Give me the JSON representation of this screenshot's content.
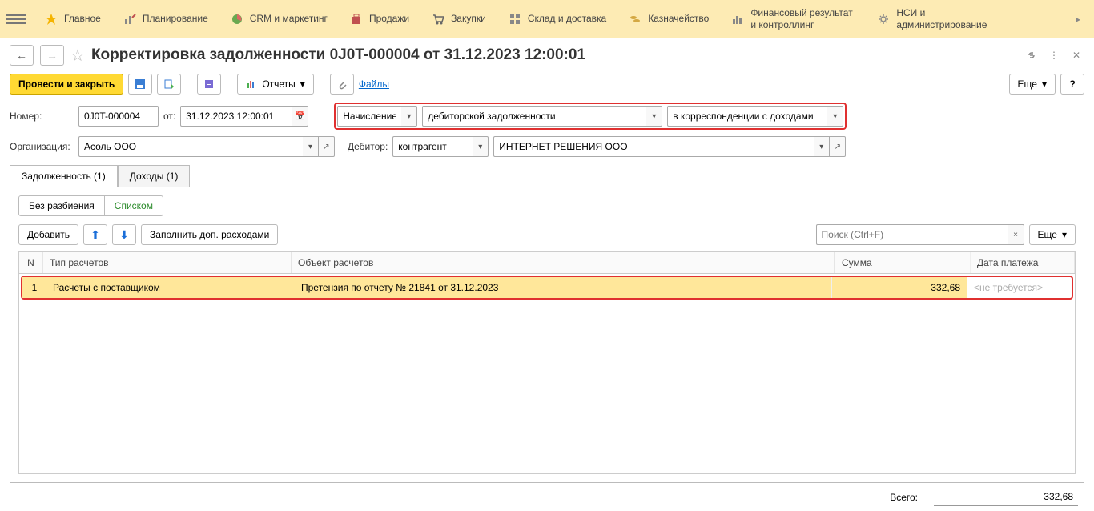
{
  "topbar": {
    "items": [
      {
        "label": "Главное"
      },
      {
        "label": "Планирование"
      },
      {
        "label": "CRM и маркетинг"
      },
      {
        "label": "Продажи"
      },
      {
        "label": "Закупки"
      },
      {
        "label": "Склад и доставка"
      },
      {
        "label": "Казначейство"
      },
      {
        "label": "Финансовый результат и контроллинг"
      },
      {
        "label": "НСИ и администрирование"
      }
    ]
  },
  "header": {
    "title": "Корректировка задолженности 0J0T-000004 от 31.12.2023 12:00:01"
  },
  "toolbar": {
    "post_close": "Провести и закрыть",
    "reports": "Отчеты",
    "files": "Файлы",
    "more": "Еще"
  },
  "form": {
    "number_label": "Номер:",
    "number_value": "0J0T-000004",
    "from_label": "от:",
    "date_value": "31.12.2023 12:00:01",
    "op1": "Начисление",
    "op2": "дебиторской задолженности",
    "op3": "в корреспонденции с доходами",
    "org_label": "Организация:",
    "org_value": "Асоль ООО",
    "debtor_label": "Дебитор:",
    "debtor_type": "контрагент",
    "debtor_value": "ИНТЕРНЕТ РЕШЕНИЯ ООО"
  },
  "tabs": {
    "t1": "Задолженность (1)",
    "t2": "Доходы (1)"
  },
  "subtabs": {
    "s1": "Без разбиения",
    "s2": "Списком"
  },
  "table": {
    "add": "Добавить",
    "fill": "Заполнить доп. расходами",
    "search_placeholder": "Поиск (Ctrl+F)",
    "more": "Еще",
    "headers": {
      "n": "N",
      "type": "Тип расчетов",
      "obj": "Объект расчетов",
      "sum": "Сумма",
      "date": "Дата платежа"
    },
    "rows": [
      {
        "n": "1",
        "type": "Расчеты с поставщиком",
        "obj": "Претензия по отчету № 21841 от 31.12.2023",
        "sum": "332,68",
        "date": "<не требуется>"
      }
    ]
  },
  "footer": {
    "total_label": "Всего:",
    "total_value": "332,68"
  }
}
